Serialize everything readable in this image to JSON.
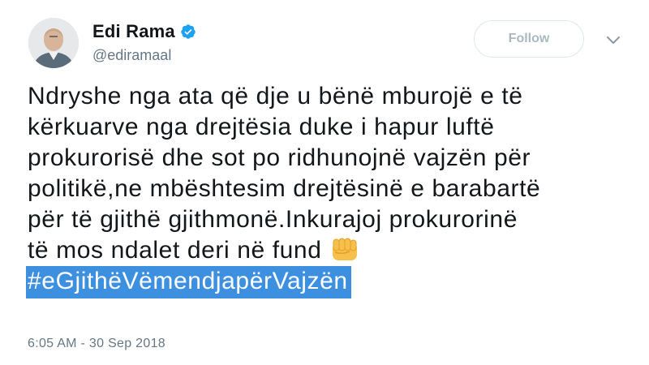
{
  "user": {
    "name": "Edi Rama",
    "handle": "@ediramaal"
  },
  "follow_button": {
    "label": "Follow"
  },
  "tweet": {
    "lines": [
      "Ndryshe nga ata që dje u bënë mburojë e të",
      "kërkuarve nga drejtësia duke i hapur luftë",
      "prokurorisë dhe sot po ridhunojnë vajzën për",
      "politikë,ne mbështesim drejtësinë e barabartë",
      "për të gjithë gjithmonë.Inkurajoj prokurorinë",
      "të mos ndalet deri në fund"
    ],
    "emoji": "raised-fist-icon",
    "hashtag": "#eGjithëVëmendjapërVajzën",
    "timestamp": "6:05 AM - 30 Sep 2018"
  },
  "colors": {
    "verified_blue": "#1da1f2",
    "hashtag_highlight": "#3d8fe0",
    "text": "#14171a",
    "muted": "#657786",
    "follow_border": "#e1e8ed"
  }
}
